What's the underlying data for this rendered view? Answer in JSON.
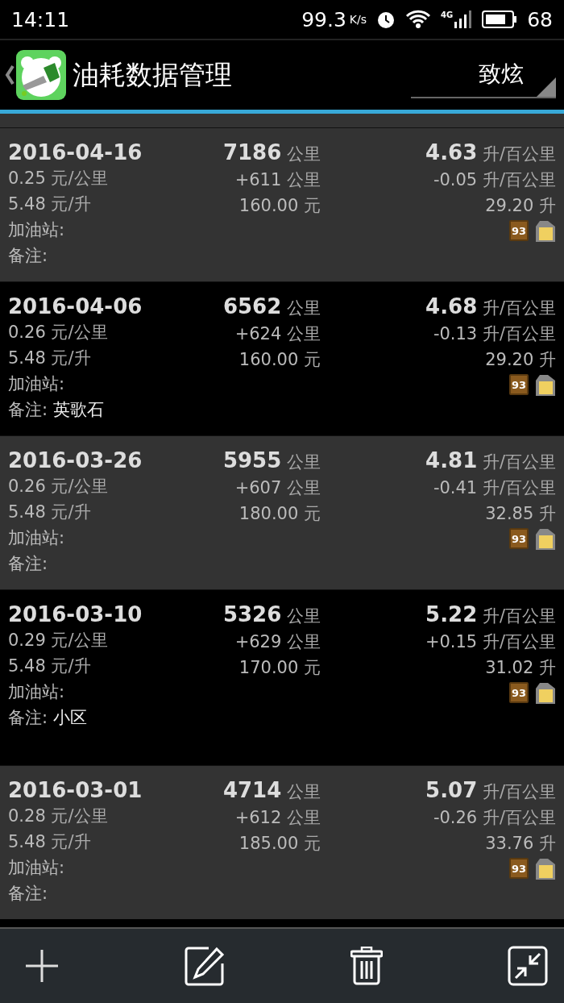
{
  "status_bar": {
    "time": "14:11",
    "net_speed": "99.3",
    "speed_unit": "K/s",
    "network": "4G",
    "battery": "68"
  },
  "header": {
    "title": "油耗数据管理",
    "vehicle": "致炫"
  },
  "records": [
    {
      "date": "2016-04-16",
      "odometer": "7186",
      "odometer_unit": "公里",
      "consumption": "4.63",
      "consumption_unit": "升/百公里",
      "cost_per_km": "0.25",
      "cost_per_km_unit": "元/公里",
      "distance": "+611",
      "distance_unit": "公里",
      "change": "-0.05",
      "change_unit": "升/百公里",
      "price": "5.48",
      "price_unit": "元/升",
      "amount": "160.00",
      "amount_unit": "元",
      "volume": "29.20",
      "volume_unit": "升",
      "station_label": "加油站:",
      "note_label": "备注:",
      "fuel_grade": "93"
    },
    {
      "date": "2016-04-06",
      "odometer": "6562",
      "odometer_unit": "公里",
      "consumption": "4.68",
      "consumption_unit": "升/百公里",
      "cost_per_km": "0.26",
      "cost_per_km_unit": "元/公里",
      "distance": "+624",
      "distance_unit": "公里",
      "change": "-0.13",
      "change_unit": "升/百公里",
      "price": "5.48",
      "price_unit": "元/升",
      "amount": "160.00",
      "amount_unit": "元",
      "volume": "29.20",
      "volume_unit": "升",
      "station_label": "加油站:",
      "note_label": "备注:",
      "note": "英歌石",
      "fuel_grade": "93"
    },
    {
      "date": "2016-03-26",
      "odometer": "5955",
      "odometer_unit": "公里",
      "consumption": "4.81",
      "consumption_unit": "升/百公里",
      "cost_per_km": "0.26",
      "cost_per_km_unit": "元/公里",
      "distance": "+607",
      "distance_unit": "公里",
      "change": "-0.41",
      "change_unit": "升/百公里",
      "price": "5.48",
      "price_unit": "元/升",
      "amount": "180.00",
      "amount_unit": "元",
      "volume": "32.85",
      "volume_unit": "升",
      "station_label": "加油站:",
      "note_label": "备注:",
      "fuel_grade": "93"
    },
    {
      "date": "2016-03-10",
      "odometer": "5326",
      "odometer_unit": "公里",
      "consumption": "5.22",
      "consumption_unit": "升/百公里",
      "cost_per_km": "0.29",
      "cost_per_km_unit": "元/公里",
      "distance": "+629",
      "distance_unit": "公里",
      "change": "+0.15",
      "change_unit": "升/百公里",
      "price": "5.48",
      "price_unit": "元/升",
      "amount": "170.00",
      "amount_unit": "元",
      "volume": "31.02",
      "volume_unit": "升",
      "station_label": "加油站:",
      "note_label": "备注:",
      "note": "小区",
      "fuel_grade": "93"
    },
    {
      "date": "2016-03-01",
      "odometer": "4714",
      "odometer_unit": "公里",
      "consumption": "5.07",
      "consumption_unit": "升/百公里",
      "cost_per_km": "0.28",
      "cost_per_km_unit": "元/公里",
      "distance": "+612",
      "distance_unit": "公里",
      "change": "-0.26",
      "change_unit": "升/百公里",
      "price": "5.48",
      "price_unit": "元/升",
      "amount": "185.00",
      "amount_unit": "元",
      "volume": "33.76",
      "volume_unit": "升",
      "station_label": "加油站:",
      "note_label": "备注:",
      "fuel_grade": "93"
    }
  ],
  "toolbar": [
    {
      "kind": "add"
    },
    {
      "kind": "edit"
    },
    {
      "kind": "delete"
    },
    {
      "kind": "collapse"
    }
  ]
}
